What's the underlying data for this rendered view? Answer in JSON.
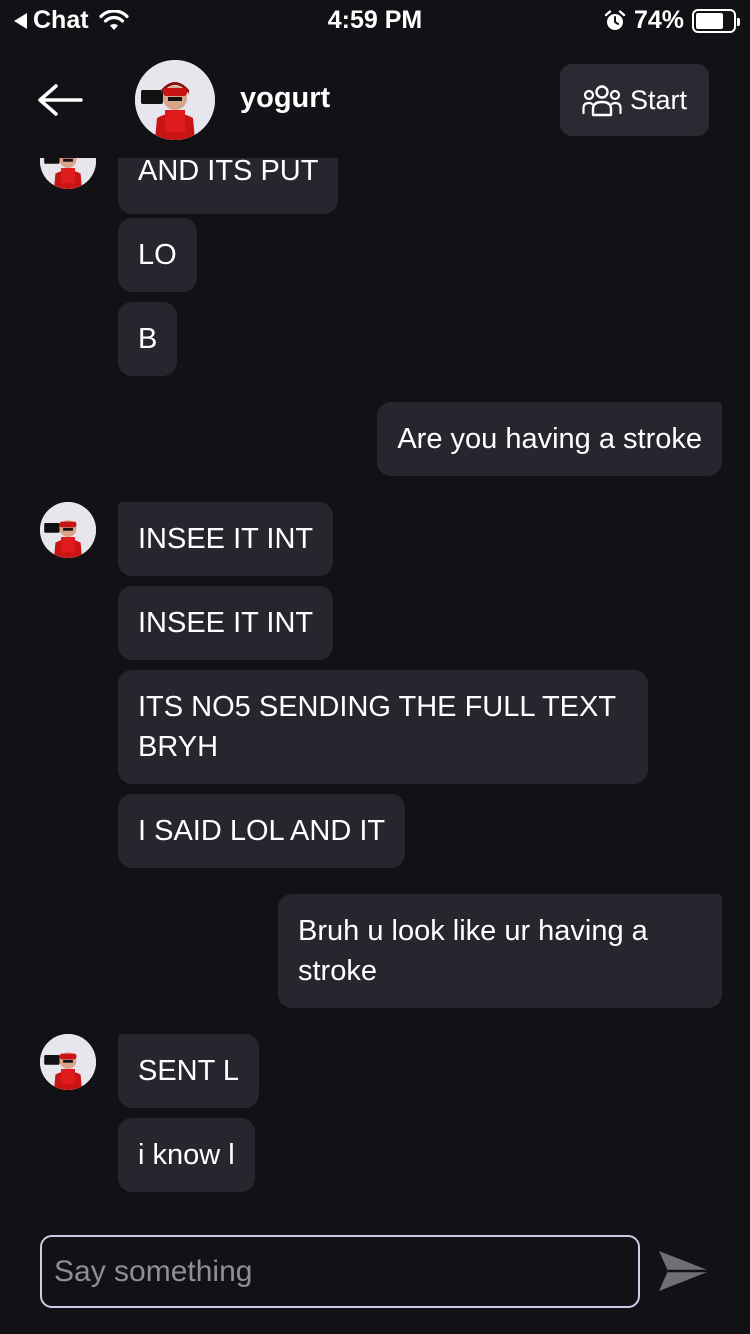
{
  "status_bar": {
    "back_app": "Chat",
    "time": "4:59 PM",
    "battery": "74%",
    "battery_level": 0.74,
    "icons": [
      "back-triangle-icon",
      "wifi-icon",
      "alarm-icon",
      "battery-icon"
    ]
  },
  "header": {
    "back_icon": "back-arrow-icon",
    "username": "yogurt",
    "start_label": "Start",
    "start_icon": "group-icon"
  },
  "messages": [
    {
      "side": "in",
      "text": "AND ITS PUT"
    },
    {
      "side": "in",
      "text": "LO"
    },
    {
      "side": "in",
      "text": "B"
    },
    {
      "side": "out",
      "text": "Are you having a stroke"
    },
    {
      "side": "in",
      "text": "INSEE IT INT"
    },
    {
      "side": "in",
      "text": "INSEE IT INT"
    },
    {
      "side": "in",
      "text": "ITS NO5 SENDING THE FULL TEXT BRYH"
    },
    {
      "side": "in",
      "text": "I SAID LOL AND IT"
    },
    {
      "side": "out",
      "text": "Bruh u look like ur having a stroke"
    },
    {
      "side": "in",
      "text": "SENT L"
    },
    {
      "side": "in",
      "text": "i know l"
    }
  ],
  "composer": {
    "placeholder": "Say something",
    "send_icon": "send-icon"
  },
  "colors": {
    "background": "#111116",
    "bubble": "#26272e",
    "button": "#2a2b32",
    "input_border": "#c9cde6",
    "placeholder": "#8d8e96"
  }
}
